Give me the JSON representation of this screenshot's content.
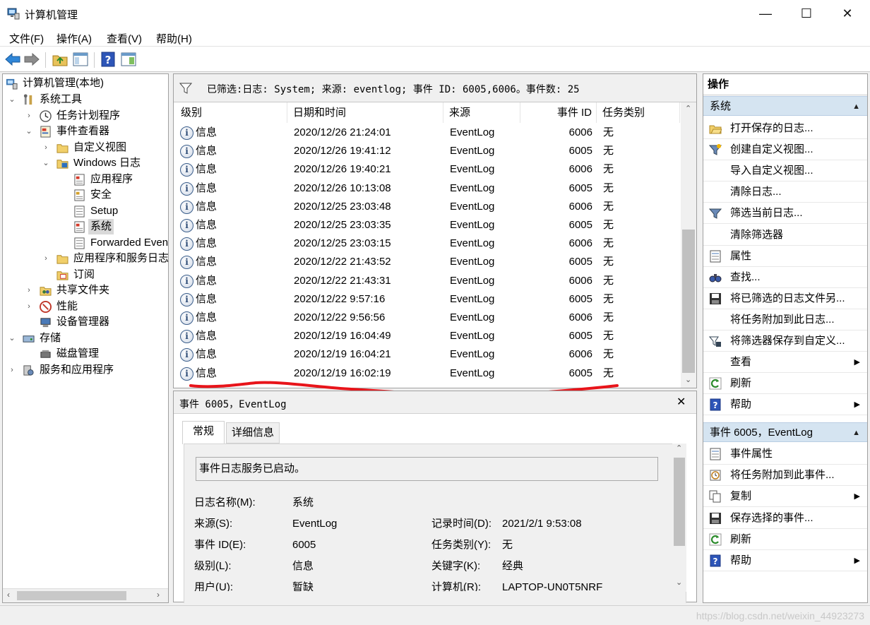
{
  "window": {
    "title": "计算机管理",
    "minimize": "—",
    "maximize": "☐",
    "close": "✕"
  },
  "menu": {
    "file": "文件(F)",
    "action": "操作(A)",
    "view": "查看(V)",
    "help": "帮助(H)"
  },
  "toolbar": {
    "back": "back-arrow",
    "forward": "forward-arrow",
    "up": "folder-up",
    "show_hide": "console-tree",
    "help": "help",
    "props": "properties"
  },
  "tree": {
    "root": "计算机管理(本地)",
    "system_tools": "系统工具",
    "task_scheduler": "任务计划程序",
    "event_viewer": "事件查看器",
    "custom_views": "自定义视图",
    "windows_logs": "Windows 日志",
    "application": "应用程序",
    "security": "安全",
    "setup": "Setup",
    "system": "系统",
    "forwarded": "Forwarded Even",
    "app_service_logs": "应用程序和服务日志",
    "subscriptions": "订阅",
    "shared_folders": "共享文件夹",
    "performance": "性能",
    "device_manager": "设备管理器",
    "storage": "存储",
    "disk_mgmt": "磁盘管理",
    "services_apps": "服务和应用程序"
  },
  "filter_text": "已筛选:日志: System; 来源: eventlog; 事件 ID: 6005,6006。事件数: 25",
  "columns": {
    "level": "级别",
    "datetime": "日期和时间",
    "source": "来源",
    "event_id": "事件 ID",
    "task": "任务类别"
  },
  "events": [
    {
      "level": "信息",
      "datetime": "2020/12/26 21:24:01",
      "source": "EventLog",
      "id": "6006",
      "task": "无"
    },
    {
      "level": "信息",
      "datetime": "2020/12/26 19:41:12",
      "source": "EventLog",
      "id": "6005",
      "task": "无"
    },
    {
      "level": "信息",
      "datetime": "2020/12/26 19:40:21",
      "source": "EventLog",
      "id": "6006",
      "task": "无"
    },
    {
      "level": "信息",
      "datetime": "2020/12/26 10:13:08",
      "source": "EventLog",
      "id": "6005",
      "task": "无"
    },
    {
      "level": "信息",
      "datetime": "2020/12/25 23:03:48",
      "source": "EventLog",
      "id": "6006",
      "task": "无"
    },
    {
      "level": "信息",
      "datetime": "2020/12/25 23:03:35",
      "source": "EventLog",
      "id": "6005",
      "task": "无"
    },
    {
      "level": "信息",
      "datetime": "2020/12/25 23:03:15",
      "source": "EventLog",
      "id": "6006",
      "task": "无"
    },
    {
      "level": "信息",
      "datetime": "2020/12/22 21:43:52",
      "source": "EventLog",
      "id": "6005",
      "task": "无"
    },
    {
      "level": "信息",
      "datetime": "2020/12/22 21:43:31",
      "source": "EventLog",
      "id": "6006",
      "task": "无"
    },
    {
      "level": "信息",
      "datetime": "2020/12/22 9:57:16",
      "source": "EventLog",
      "id": "6005",
      "task": "无"
    },
    {
      "level": "信息",
      "datetime": "2020/12/22 9:56:56",
      "source": "EventLog",
      "id": "6006",
      "task": "无"
    },
    {
      "level": "信息",
      "datetime": "2020/12/19 16:04:49",
      "source": "EventLog",
      "id": "6005",
      "task": "无"
    },
    {
      "level": "信息",
      "datetime": "2020/12/19 16:04:21",
      "source": "EventLog",
      "id": "6006",
      "task": "无"
    },
    {
      "level": "信息",
      "datetime": "2020/12/19 16:02:19",
      "source": "EventLog",
      "id": "6005",
      "task": "无"
    }
  ],
  "detail": {
    "header": "事件 6005，EventLog",
    "close": "✕",
    "tab_general": "常规",
    "tab_details": "详细信息",
    "description": "事件日志服务已启动。",
    "log_name_label": "日志名称(M):",
    "log_name": "系统",
    "source_label": "来源(S):",
    "source": "EventLog",
    "logged_label": "记录时间(D):",
    "logged": "2021/2/1 9:53:08",
    "event_id_label": "事件 ID(E):",
    "event_id": "6005",
    "task_label": "任务类别(Y):",
    "task": "无",
    "level_label": "级别(L):",
    "level": "信息",
    "keywords_label": "关键字(K):",
    "keywords": "经典",
    "user_label": "用户(U):",
    "user": "暂缺",
    "computer_label": "计算机(R):",
    "computer": "LAPTOP-UN0T5NRF"
  },
  "actions": {
    "title": "操作",
    "section_system": "系统",
    "items_system": [
      {
        "label": "打开保存的日志...",
        "icon": "open-folder-icon",
        "submenu": false
      },
      {
        "label": "创建自定义视图...",
        "icon": "funnel-star-icon",
        "submenu": false
      },
      {
        "label": "导入自定义视图...",
        "icon": "",
        "submenu": false
      },
      {
        "label": "清除日志...",
        "icon": "",
        "submenu": false
      },
      {
        "label": "筛选当前日志...",
        "icon": "funnel-icon",
        "submenu": false
      },
      {
        "label": "清除筛选器",
        "icon": "",
        "submenu": false
      },
      {
        "label": "属性",
        "icon": "properties-icon",
        "submenu": false
      },
      {
        "label": "查找...",
        "icon": "binoculars-icon",
        "submenu": false
      },
      {
        "label": "将已筛选的日志文件另...",
        "icon": "save-icon",
        "submenu": false
      },
      {
        "label": "将任务附加到此日志...",
        "icon": "",
        "submenu": false
      },
      {
        "label": "将筛选器保存到自定义...",
        "icon": "funnel-save-icon",
        "submenu": false
      },
      {
        "label": "查看",
        "icon": "",
        "submenu": true
      },
      {
        "label": "刷新",
        "icon": "refresh-icon",
        "submenu": false
      },
      {
        "label": "帮助",
        "icon": "help-icon",
        "submenu": true
      }
    ],
    "section_event": "事件 6005，EventLog",
    "items_event": [
      {
        "label": "事件属性",
        "icon": "properties-icon",
        "submenu": false
      },
      {
        "label": "将任务附加到此事件...",
        "icon": "task-icon",
        "submenu": false
      },
      {
        "label": "复制",
        "icon": "copy-icon",
        "submenu": true
      },
      {
        "label": "保存选择的事件...",
        "icon": "save-icon",
        "submenu": false
      },
      {
        "label": "刷新",
        "icon": "refresh-icon",
        "submenu": false
      },
      {
        "label": "帮助",
        "icon": "help-icon",
        "submenu": true
      }
    ]
  },
  "watermark": "https://blog.csdn.net/weixin_44923273",
  "colors": {
    "accent": "#d5e4f1",
    "annotation": "#e8141a"
  }
}
